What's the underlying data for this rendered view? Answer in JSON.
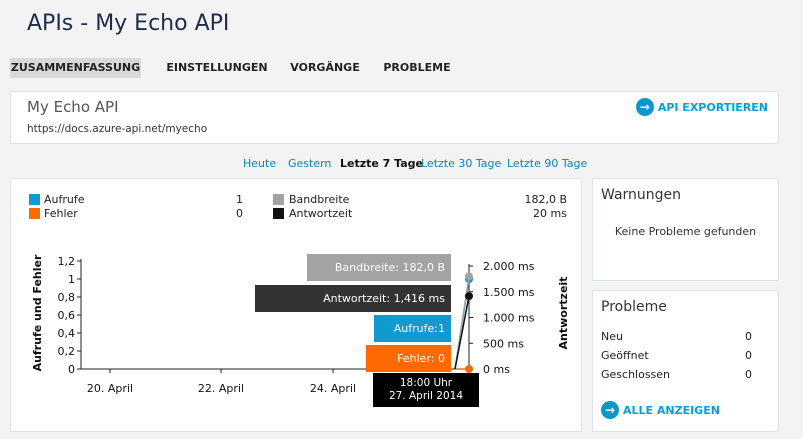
{
  "header": {
    "title": "APIs - My Echo API"
  },
  "tabs": [
    {
      "label": "ZUSAMMENFASSUNG",
      "active": true
    },
    {
      "label": "EINSTELLUNGEN",
      "active": false
    },
    {
      "label": "VORGÄNGE",
      "active": false
    },
    {
      "label": "PROBLEME",
      "active": false
    }
  ],
  "api": {
    "name": "My Echo API",
    "url": "https://docs.azure-api.net/myecho",
    "export_label": "API EXPORTIEREN"
  },
  "time_ranges": [
    {
      "label": "Heute",
      "active": false
    },
    {
      "label": "Gestern",
      "active": false
    },
    {
      "label": "Letzte 7 Tage",
      "active": true
    },
    {
      "label": "Letzte 30 Tage",
      "active": false
    },
    {
      "label": "Letzte 90 Tage",
      "active": false
    }
  ],
  "legend": [
    {
      "label": "Aufrufe",
      "value": "1",
      "color": "#1199d1"
    },
    {
      "label": "Fehler",
      "value": "0",
      "color": "#ff6a00"
    },
    {
      "label": "Bandbreite",
      "value": "182,0 B",
      "color": "#a3a3a3"
    },
    {
      "label": "Antwortzeit",
      "value": "20 ms",
      "color": "#111111"
    }
  ],
  "chart_data": {
    "type": "line",
    "left_axis": {
      "label": "Aufrufe und Fehler",
      "ticks": [
        "0",
        "0,2",
        "0,4",
        "0,6",
        "0,8",
        "1",
        "1,2"
      ],
      "range": [
        0,
        1.2
      ]
    },
    "right_axis": {
      "label": "Antwortzeit",
      "ticks": [
        "0 ms",
        "500 ms",
        "1.000 ms",
        "1.500 ms",
        "2.000 ms"
      ],
      "range": [
        0,
        2000
      ]
    },
    "x_ticks": [
      "20. April",
      "22. April",
      "24. April"
    ],
    "series": [
      {
        "name": "Aufrufe",
        "color": "#1199d1",
        "values": [
          0,
          1
        ]
      },
      {
        "name": "Fehler",
        "color": "#ff6a00",
        "values": [
          0,
          0
        ]
      },
      {
        "name": "Bandbreite",
        "color": "#a3a3a3",
        "values": [
          0,
          182
        ]
      },
      {
        "name": "Antwortzeit",
        "color": "#111111",
        "values": [
          0,
          1416
        ]
      }
    ],
    "tooltip": {
      "time": "18:00 Uhr",
      "date": "27. April 2014",
      "items": [
        {
          "label": "Bandbreite: 182,0 B",
          "color": "#a3a3a3"
        },
        {
          "label": "Antwortzeit: 1,416 ms",
          "color": "#333333"
        },
        {
          "label": "Aufrufe:1",
          "color": "#1199d1"
        },
        {
          "label": "Fehler: 0",
          "color": "#ff6a00"
        }
      ]
    }
  },
  "warnings": {
    "title": "Warnungen",
    "message": "Keine Probleme gefunden"
  },
  "issues": {
    "title": "Probleme",
    "rows": [
      {
        "label": "Neu",
        "value": "0"
      },
      {
        "label": "Geöffnet",
        "value": "0"
      },
      {
        "label": "Geschlossen",
        "value": "0"
      }
    ],
    "link_label": "ALLE ANZEIGEN"
  }
}
